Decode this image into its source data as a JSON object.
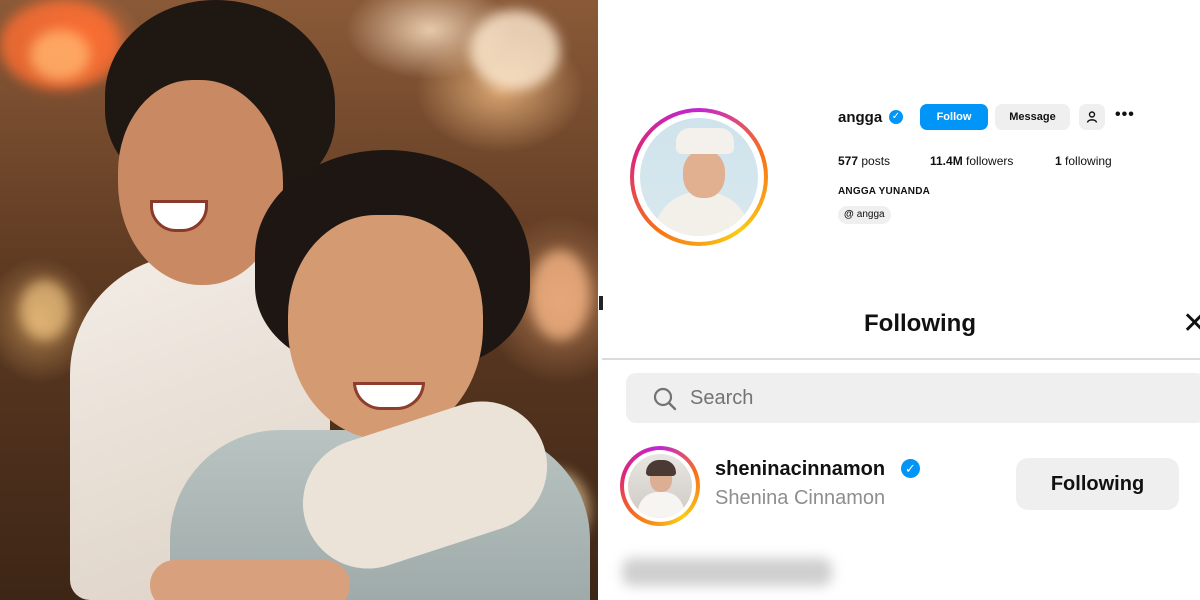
{
  "profile": {
    "username": "angga",
    "follow_label": "Follow",
    "message_label": "Message",
    "suggest_label": "+̺",
    "more_label": "•••",
    "posts_count": "577",
    "posts_label": "posts",
    "followers_count": "11.4M",
    "followers_label": "followers",
    "following_count": "1",
    "following_label": "following",
    "full_name": "ANGGA YUNANDA",
    "threads_handle": "angga",
    "verified": true
  },
  "modal": {
    "title": "Following",
    "close_label": "✕",
    "search": {
      "placeholder": "Search"
    },
    "items": [
      {
        "username": "sheninacinnamon",
        "full_name": "Shenina Cinnamon",
        "verified": true,
        "button_label": "Following"
      }
    ]
  },
  "colors": {
    "accent": "#0095f6",
    "button_gray": "#efefef",
    "secondary_text": "#8e8e8e"
  },
  "icons": {
    "verified": "verified-badge-icon",
    "search": "search-icon",
    "close": "close-icon",
    "threads": "threads-icon",
    "more": "more-icon",
    "suggest": "add-person-icon"
  }
}
